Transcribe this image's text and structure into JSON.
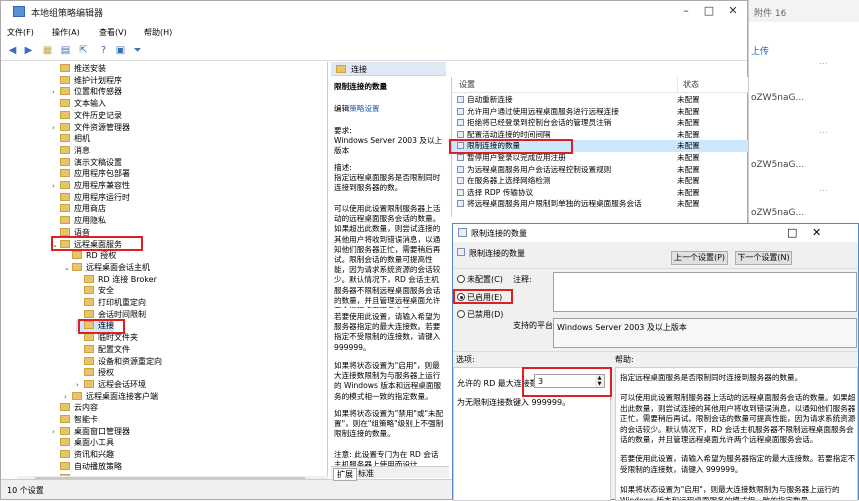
{
  "bg": {
    "tabs": "附件 16",
    "right_lines": [
      "上传",
      "oZW5naG...",
      "oZW5naG...",
      "oZW5naG..."
    ],
    "right_more": [
      "...",
      "...",
      "..."
    ]
  },
  "main": {
    "title": "本地组策略编辑器",
    "menus": [
      "文件(F)",
      "操作(A)",
      "查看(V)",
      "帮助(H)"
    ],
    "toolbar_icons": [
      "back-icon",
      "forward-icon",
      "folder-icon",
      "list-icon",
      "export-icon",
      "help-icon",
      "properties-icon",
      "filter-icon"
    ]
  },
  "tree": [
    {
      "label": "推送安装",
      "indent": 4,
      "exp": ""
    },
    {
      "label": "维护计划程序",
      "indent": 4,
      "exp": ""
    },
    {
      "label": "位置和传感器",
      "indent": 4,
      "exp": ">"
    },
    {
      "label": "文本输入",
      "indent": 4,
      "exp": ""
    },
    {
      "label": "文件历史记录",
      "indent": 4,
      "exp": ""
    },
    {
      "label": "文件资源管理器",
      "indent": 4,
      "exp": ">"
    },
    {
      "label": "相机",
      "indent": 4,
      "exp": ""
    },
    {
      "label": "消息",
      "indent": 4,
      "exp": ""
    },
    {
      "label": "演示文稿设置",
      "indent": 4,
      "exp": ""
    },
    {
      "label": "应用程序包部署",
      "indent": 4,
      "exp": ""
    },
    {
      "label": "应用程序兼容性",
      "indent": 4,
      "exp": ">"
    },
    {
      "label": "应用程序运行时",
      "indent": 4,
      "exp": ""
    },
    {
      "label": "应用商店",
      "indent": 4,
      "exp": ""
    },
    {
      "label": "应用隐私",
      "indent": 4,
      "exp": ""
    },
    {
      "label": "语音",
      "indent": 4,
      "exp": ""
    },
    {
      "label": "远程桌面服务",
      "indent": 4,
      "exp": "v"
    },
    {
      "label": "RD 授权",
      "indent": 5,
      "exp": ""
    },
    {
      "label": "远程桌面会话主机",
      "indent": 5,
      "exp": "v"
    },
    {
      "label": "RD 连接 Broker",
      "indent": 6,
      "exp": ""
    },
    {
      "label": "安全",
      "indent": 6,
      "exp": ""
    },
    {
      "label": "打印机重定向",
      "indent": 6,
      "exp": ""
    },
    {
      "label": "会话时间限制",
      "indent": 6,
      "exp": ""
    },
    {
      "label": "连接",
      "indent": 6,
      "exp": ""
    },
    {
      "label": "临时文件夹",
      "indent": 6,
      "exp": ""
    },
    {
      "label": "配置文件",
      "indent": 6,
      "exp": ""
    },
    {
      "label": "设备和资源重定向",
      "indent": 6,
      "exp": ""
    },
    {
      "label": "授权",
      "indent": 6,
      "exp": ""
    },
    {
      "label": "远程会话环境",
      "indent": 6,
      "exp": ">"
    },
    {
      "label": "远程桌面连接客户端",
      "indent": 5,
      "exp": ">"
    },
    {
      "label": "云内容",
      "indent": 4,
      "exp": ""
    },
    {
      "label": "智能卡",
      "indent": 4,
      "exp": ""
    },
    {
      "label": "桌面窗口管理器",
      "indent": 4,
      "exp": ">"
    },
    {
      "label": "桌面小工具",
      "indent": 4,
      "exp": ""
    },
    {
      "label": "资讯和兴趣",
      "indent": 4,
      "exp": ""
    },
    {
      "label": "自动播放策略",
      "indent": 4,
      "exp": ""
    },
    {
      "label": "...",
      "indent": 4,
      "exp": ""
    }
  ],
  "status": "10 个设置",
  "mid": {
    "header": "连接",
    "title": "限制连接的数量",
    "edit_prefix": "编辑",
    "edit_link": "策略设置",
    "req_label": "要求:",
    "req_text": "Windows Server 2003 及以上版本",
    "desc_label": "描述:",
    "desc1": "指定远程桌面服务是否限制同时连接到服务器的数。",
    "desc2": "可以使用此设置限制服务器上活动的远程桌面服务会话的数量。如果超出此数量，则尝试连接的其他用户将收到错误消息，以通知他们服务器正忙，需要稍后再试。限制会话的数量可提高性能，因为请求系统资源的会话较少。默认情况下，RD 会话主机服务器不限制远程桌面服务会话的数量，并且管理远程桌面允许两个远程桌面服务会话。",
    "desc3": "若要使用此设置，请输入希望为服务器指定的最大连接数。若要指定不受限制的连接数，请键入 999999。",
    "desc4": "如果将状态设置为\"启用\"，则最大连接数限制为与服务器上运行的 Windows 版本和远程桌面服务的模式相一致的指定数量。",
    "desc5": "如果将状态设置为\"禁用\"或\"未配置\"，则在\"组策略\"级别上不强制限制连接的数量。",
    "desc6": "注意: 此设置专门为在 RD 会话主机服务器上使用而设计...",
    "tabs": [
      "扩展",
      "标准"
    ]
  },
  "list": {
    "col_setting": "设置",
    "col_state": "状态",
    "rows": [
      {
        "name": "自动重新连接",
        "state": "未配置"
      },
      {
        "name": "允许用户通过使用远程桌面服务进行远程连接",
        "state": "未配置"
      },
      {
        "name": "拒绝将已经登录到控制台会话的管理员注销",
        "state": "未配置"
      },
      {
        "name": "配置活动连接的时间间隔",
        "state": "未配置"
      },
      {
        "name": "限制连接的数量",
        "state": "未配置"
      },
      {
        "name": "暂停用户登录以完成应用注册",
        "state": "未配置"
      },
      {
        "name": "为远程桌面服务用户会话远程控制设置规则",
        "state": "未配置"
      },
      {
        "name": "在服务器上选择网络检测",
        "state": "未配置"
      },
      {
        "name": "选择 RDP 传输协议",
        "state": "未配置"
      },
      {
        "name": "将远程桌面服务用户限制到单独的远程桌面服务会话",
        "state": "未配置"
      }
    ]
  },
  "dialog": {
    "title": "限制连接的数量",
    "subtitle": "限制连接的数量",
    "prev_btn": "上一个设置(P)",
    "next_btn": "下一个设置(N)",
    "opt_unconfigured": "未配置(C)",
    "opt_enabled": "已启用(E)",
    "opt_disabled": "已禁用(D)",
    "comment_label": "注释:",
    "supported_label": "支持的平台:",
    "supported_value": "Windows Server 2003 及以上版本",
    "options_label": "选项:",
    "help_label": "帮助:",
    "max_label": "允许的 RD 最大连接数",
    "max_value": "3",
    "unlimited_hint": "为无限制连接数键入 999999。",
    "help1": "指定远程桌面服务是否限制同时连接到服务器的数量。",
    "help2": "可以使用此设置限制服务器上活动的远程桌面服务会话的数量。如果超出此数量，则尝试连接的其他用户将收到错误消息，以通知他们服务器正忙，需要稍后再试。限制会话的数量可提高性能，因为请求系统资源的会话较少。默认情况下，RD 会话主机服务器不限制远程桌面服务会话的数量，并且管理远程桌面允许两个远程桌面服务会话。",
    "help3": "若要使用此设置，请输入希望为服务器指定的最大连接数。若要指定不受限制的连接数，请键入 999999。",
    "help4": "如果将状态设置为\"启用\"，则最大连接数限制为与服务器上运行的 Windows 版本和远程桌面服务的模式相一致的指定数量。"
  },
  "colors": {
    "highlight": "#cce8ff",
    "red": "#e02020",
    "link": "#1a5fb4"
  }
}
